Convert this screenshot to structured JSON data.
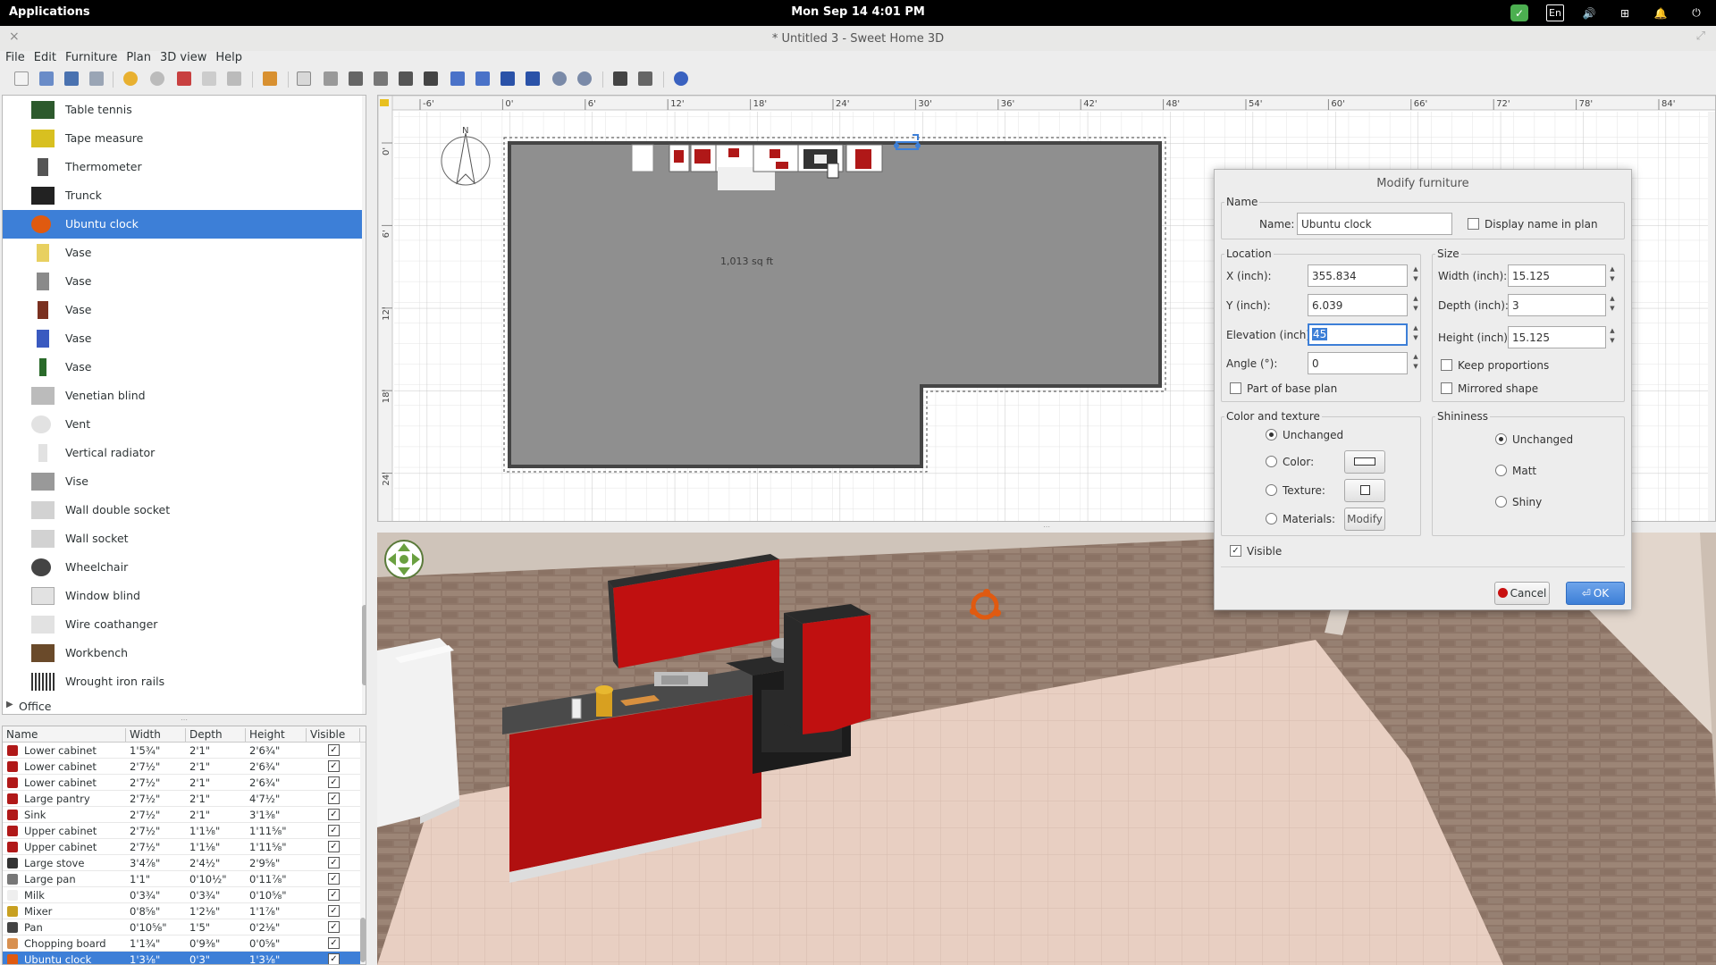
{
  "topbar": {
    "apps": "Applications",
    "clock": "Mon Sep 14     4:01 PM",
    "lang": "En"
  },
  "window": {
    "title": "* Untitled 3 - Sweet Home 3D"
  },
  "menu": [
    "File",
    "Edit",
    "Furniture",
    "Plan",
    "3D view",
    "Help"
  ],
  "catalog": {
    "items": [
      {
        "label": "Table tennis",
        "color": "#2d5a2d"
      },
      {
        "label": "Tape measure",
        "color": "#d8c020"
      },
      {
        "label": "Thermometer",
        "color": "#555555"
      },
      {
        "label": "Trunck",
        "color": "#222222"
      },
      {
        "label": "Ubuntu clock",
        "color": "#e05a10"
      },
      {
        "label": "Vase",
        "color": "#e8d060"
      },
      {
        "label": "Vase",
        "color": "#8a8a8a"
      },
      {
        "label": "Vase",
        "color": "#7a3020"
      },
      {
        "label": "Vase",
        "color": "#3a5ac0"
      },
      {
        "label": "Vase",
        "color": "#2a6a2a"
      },
      {
        "label": "Venetian blind",
        "color": "#bbbbbb"
      },
      {
        "label": "Vent",
        "color": "#dddddd"
      },
      {
        "label": "Vertical radiator",
        "color": "#dddddd"
      },
      {
        "label": "Vise",
        "color": "#999999"
      },
      {
        "label": "Wall double socket",
        "color": "#cccccc"
      },
      {
        "label": "Wall socket",
        "color": "#cccccc"
      },
      {
        "label": "Wheelchair",
        "color": "#444444"
      },
      {
        "label": "Window blind",
        "color": "#dddddd"
      },
      {
        "label": "Wire coathanger",
        "color": "#cccccc"
      },
      {
        "label": "Workbench",
        "color": "#6a4a2a"
      },
      {
        "label": "Wrought iron rails",
        "color": "#333333"
      }
    ],
    "category": "Office"
  },
  "table": {
    "headers": [
      "Name",
      "Width",
      "Depth",
      "Height",
      "Visible"
    ],
    "rows": [
      {
        "name": "Lower cabinet",
        "w": "1'5¾\"",
        "d": "2'1\"",
        "h": "2'6¾\"",
        "c": "#b01818"
      },
      {
        "name": "Lower cabinet",
        "w": "2'7½\"",
        "d": "2'1\"",
        "h": "2'6¾\"",
        "c": "#b01818"
      },
      {
        "name": "Lower cabinet",
        "w": "2'7½\"",
        "d": "2'1\"",
        "h": "2'6¾\"",
        "c": "#b01818"
      },
      {
        "name": "Large pantry",
        "w": "2'7½\"",
        "d": "2'1\"",
        "h": "4'7½\"",
        "c": "#b01818"
      },
      {
        "name": "Sink",
        "w": "2'7½\"",
        "d": "2'1\"",
        "h": "3'1⅜\"",
        "c": "#b01818"
      },
      {
        "name": "Upper cabinet",
        "w": "2'7½\"",
        "d": "1'1⅛\"",
        "h": "1'11⅝\"",
        "c": "#b01818"
      },
      {
        "name": "Upper cabinet",
        "w": "2'7½\"",
        "d": "1'1⅛\"",
        "h": "1'11⅝\"",
        "c": "#b01818"
      },
      {
        "name": "Large stove",
        "w": "3'4⅞\"",
        "d": "2'4½\"",
        "h": "2'9⅝\"",
        "c": "#333333"
      },
      {
        "name": "Large pan",
        "w": "1'1\"",
        "d": "0'10½\"",
        "h": "0'11⅞\"",
        "c": "#777777"
      },
      {
        "name": "Milk",
        "w": "0'3¾\"",
        "d": "0'3¾\"",
        "h": "0'10⅝\"",
        "c": "#eeeeee"
      },
      {
        "name": "Mixer",
        "w": "0'8⅝\"",
        "d": "1'2⅛\"",
        "h": "1'1⅞\"",
        "c": "#c8a020"
      },
      {
        "name": "Pan",
        "w": "0'10⅝\"",
        "d": "1'5\"",
        "h": "0'2⅛\"",
        "c": "#444444"
      },
      {
        "name": "Chopping board",
        "w": "1'1¾\"",
        "d": "0'9⅜\"",
        "h": "0'0⅝\"",
        "c": "#d89050"
      },
      {
        "name": "Ubuntu clock",
        "w": "1'3⅛\"",
        "d": "0'3\"",
        "h": "1'3⅛\"",
        "c": "#e05a10"
      }
    ]
  },
  "plan": {
    "ruler_labels": [
      "-6'",
      "0'",
      "6'",
      "12'",
      "18'",
      "24'",
      "30'",
      "36'",
      "42'",
      "48'",
      "54'",
      "60'",
      "66'",
      "72'",
      "78'",
      "84'"
    ],
    "vruler_labels": [
      "0'",
      "6'",
      "12'",
      "18'",
      "24'"
    ],
    "area": "1,013 sq ft"
  },
  "dialog": {
    "title": "Modify furniture",
    "name_group": "Name",
    "name_label": "Name:",
    "name_value": "Ubuntu clock",
    "display_name": "Display name in plan",
    "location_group": "Location",
    "x_label": "X (inch):",
    "x_value": "355.834",
    "y_label": "Y (inch):",
    "y_value": "6.039",
    "elev_label": "Elevation (inch):",
    "elev_value": "45",
    "angle_label": "Angle (°):",
    "angle_value": "0",
    "base_plan": "Part of base plan",
    "size_group": "Size",
    "width_label": "Width (inch):",
    "width_value": "15.125",
    "depth_label": "Depth (inch):",
    "depth_value": "3",
    "height_label": "Height (inch):",
    "height_value": "15.125",
    "keep_prop": "Keep proportions",
    "mirrored": "Mirrored shape",
    "color_group": "Color and texture",
    "unchanged": "Unchanged",
    "color": "Color:",
    "texture": "Texture:",
    "materials": "Materials:",
    "modify": "Modify",
    "shininess_group": "Shininess",
    "s_unchanged": "Unchanged",
    "matt": "Matt",
    "shiny": "Shiny",
    "visible": "Visible",
    "cancel": "Cancel",
    "ok": "OK"
  }
}
